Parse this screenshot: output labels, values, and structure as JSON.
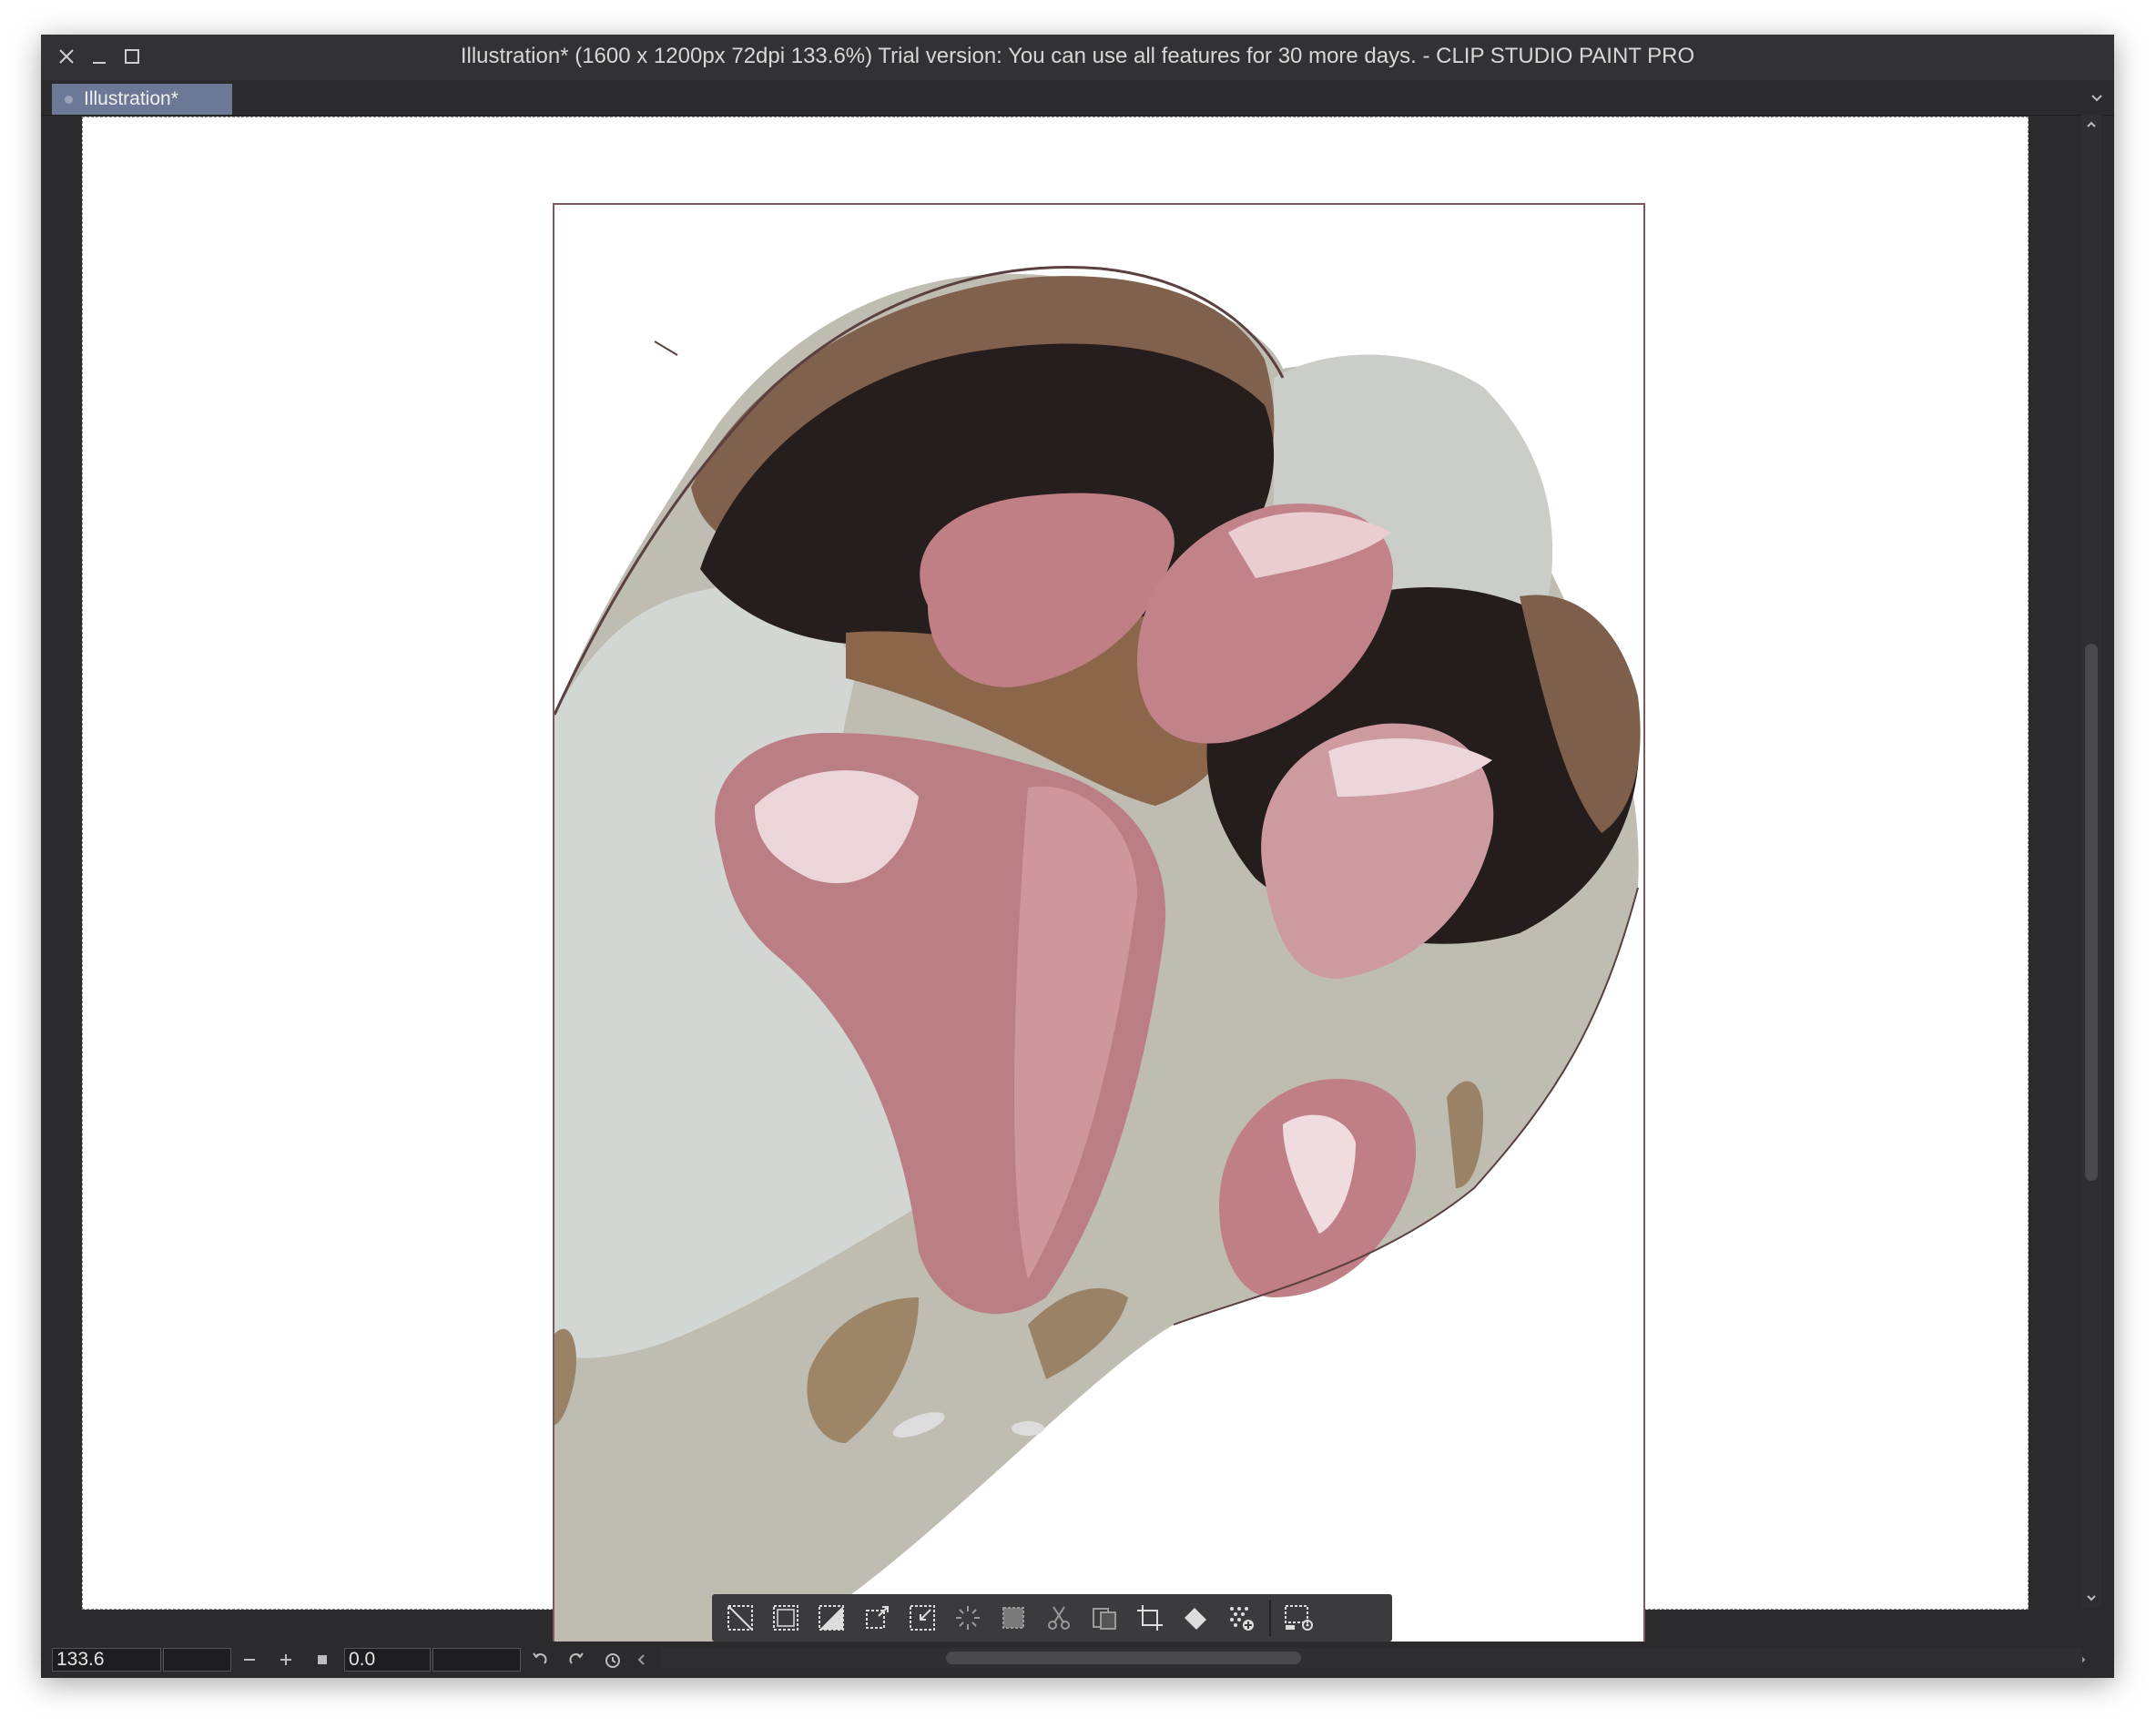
{
  "window": {
    "title": "Illustration* (1600 x 1200px 72dpi 133.6%)  Trial version: You can use all features for 30 more days. - CLIP STUDIO PAINT PRO",
    "controls": [
      "close-icon",
      "minimize-icon",
      "maximize-icon"
    ]
  },
  "tabs": [
    {
      "label": "Illustration*",
      "active": true
    }
  ],
  "canvas": {
    "description_colors": {
      "fur_light": "#d2d6d2",
      "fur_gray": "#bebbb0",
      "fur_brown": "#7e5f4b",
      "fur_dark": "#241b1b",
      "pad_pink": "#c27d86",
      "pad_highlight": "#eed8db",
      "tan": "#9d8566"
    }
  },
  "selection_launcher": {
    "tools": [
      "deselect-icon",
      "select-all-icon",
      "invert-selection-icon",
      "expand-selection-icon",
      "shrink-selection-icon",
      "selection-spinner-icon",
      "fill-selection-icon",
      "cut-icon",
      "copy-paste-icon",
      "crop-icon",
      "fill-icon",
      "tone-icon",
      "selection-settings-icon"
    ]
  },
  "statusbar": {
    "zoom": "133.6",
    "rotation": "0.0",
    "icons": [
      "zoom-out-icon",
      "zoom-in-icon",
      "fit-icon",
      "rotate-left-icon",
      "rotate-right-icon",
      "reset-rotation-icon",
      "scroll-left-icon",
      "scroll-right-icon"
    ]
  },
  "scroll": {
    "vertical_fraction_start": 0.35,
    "vertical_fraction_end": 0.72,
    "horizontal_fraction_start": 0.2,
    "horizontal_fraction_end": 0.45
  }
}
